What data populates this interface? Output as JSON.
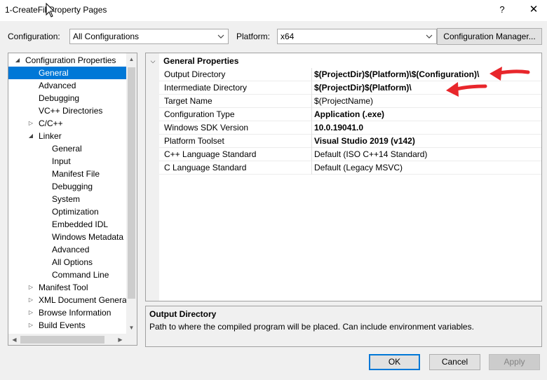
{
  "window": {
    "title": "1-CreateFil Property Pages",
    "help_label": "?",
    "close_label": "✕"
  },
  "toolbar": {
    "configuration_label": "Configuration:",
    "configuration_value": "All Configurations",
    "platform_label": "Platform:",
    "platform_value": "x64",
    "config_manager_label": "Configuration Manager..."
  },
  "tree": {
    "items": [
      {
        "label": "Configuration Properties",
        "expander": "◢"
      },
      {
        "label": "General",
        "expander": ""
      },
      {
        "label": "Advanced",
        "expander": ""
      },
      {
        "label": "Debugging",
        "expander": ""
      },
      {
        "label": "VC++ Directories",
        "expander": ""
      },
      {
        "label": "C/C++",
        "expander": "▷"
      },
      {
        "label": "Linker",
        "expander": "◢"
      },
      {
        "label": "General",
        "expander": ""
      },
      {
        "label": "Input",
        "expander": ""
      },
      {
        "label": "Manifest File",
        "expander": ""
      },
      {
        "label": "Debugging",
        "expander": ""
      },
      {
        "label": "System",
        "expander": ""
      },
      {
        "label": "Optimization",
        "expander": ""
      },
      {
        "label": "Embedded IDL",
        "expander": ""
      },
      {
        "label": "Windows Metadata",
        "expander": ""
      },
      {
        "label": "Advanced",
        "expander": ""
      },
      {
        "label": "All Options",
        "expander": ""
      },
      {
        "label": "Command Line",
        "expander": ""
      },
      {
        "label": "Manifest Tool",
        "expander": "▷"
      },
      {
        "label": "XML Document Genera",
        "expander": "▷"
      },
      {
        "label": "Browse Information",
        "expander": "▷"
      },
      {
        "label": "Build Events",
        "expander": "▷"
      }
    ],
    "scroll": {
      "up": "▲",
      "down": "▼",
      "left": "◀",
      "right": "▶"
    }
  },
  "grid": {
    "section_title": "General Properties",
    "section_expander": "⌵",
    "rows": [
      {
        "name": "Output Directory",
        "value": "$(ProjectDir)$(Platform)\\$(Configuration)\\"
      },
      {
        "name": "Intermediate Directory",
        "value": "$(ProjectDir)$(Platform)\\"
      },
      {
        "name": "Target Name",
        "value": "$(ProjectName)"
      },
      {
        "name": "Configuration Type",
        "value": "Application (.exe)"
      },
      {
        "name": "Windows SDK Version",
        "value": "10.0.19041.0"
      },
      {
        "name": "Platform Toolset",
        "value": "Visual Studio 2019 (v142)"
      },
      {
        "name": "C++ Language Standard",
        "value": "Default (ISO C++14 Standard)"
      },
      {
        "name": "C Language Standard",
        "value": "Default (Legacy MSVC)"
      }
    ]
  },
  "description": {
    "title": "Output Directory",
    "text": "Path to where the compiled program will be placed. Can include environment variables."
  },
  "buttons": {
    "ok": "OK",
    "cancel": "Cancel",
    "apply": "Apply"
  },
  "colors": {
    "accent": "#0078d7",
    "annotation_arrow": "#e8262b"
  }
}
